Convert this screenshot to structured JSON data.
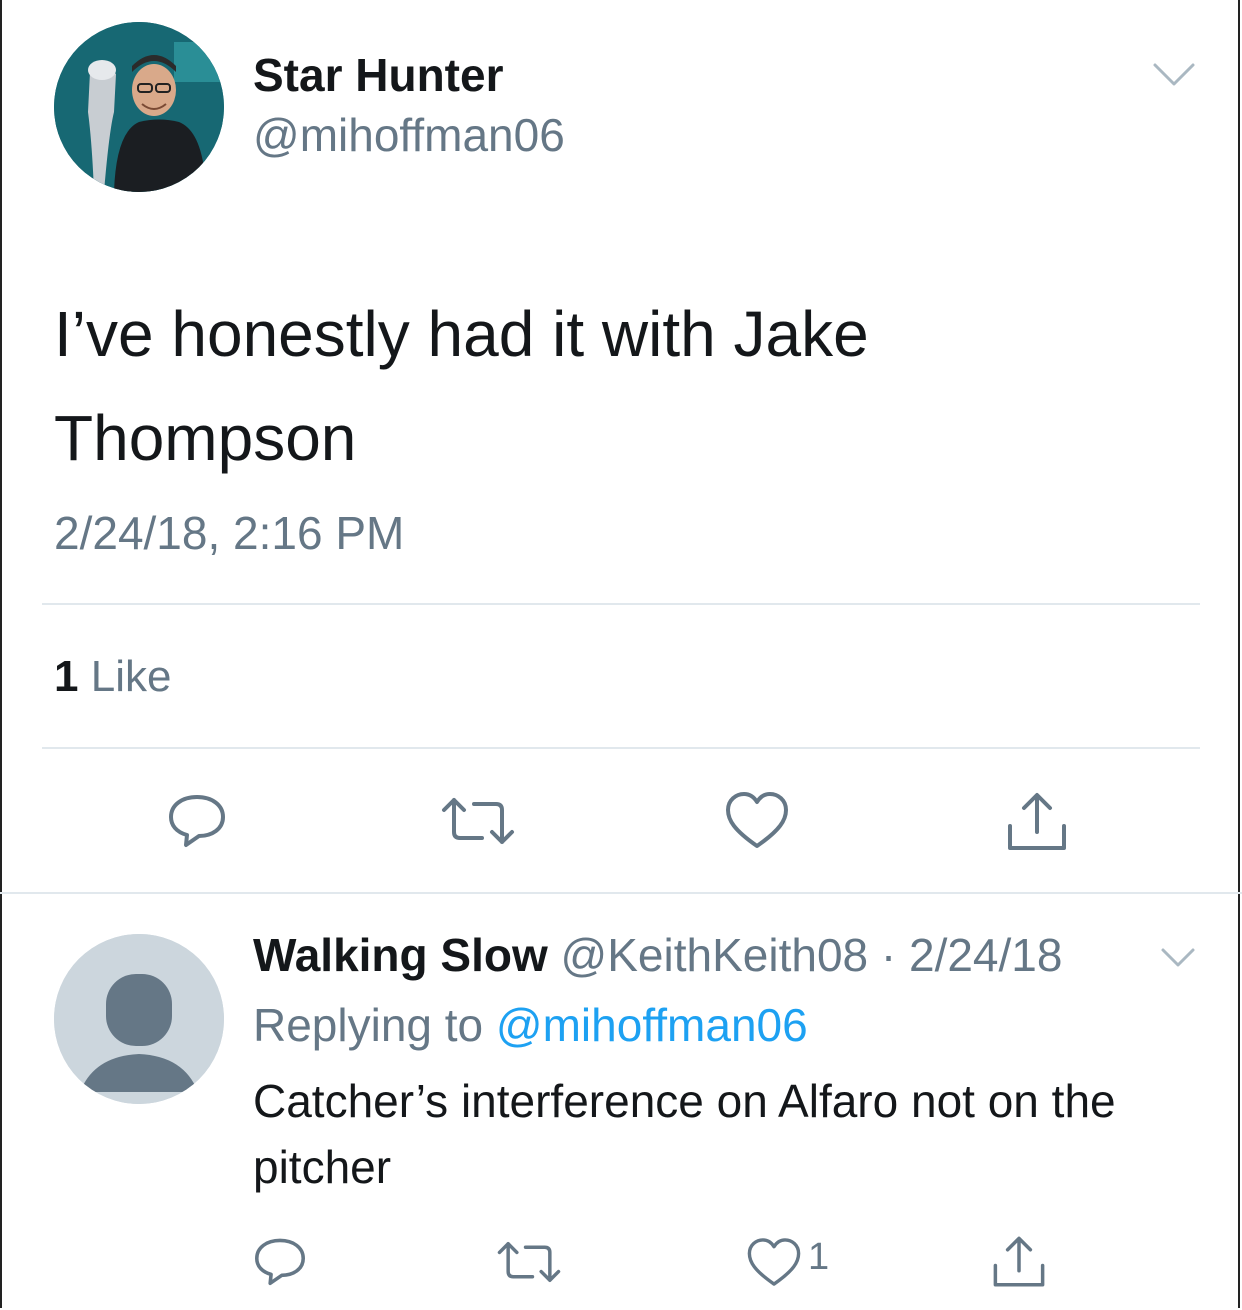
{
  "main_tweet": {
    "display_name": "Star Hunter",
    "handle": "@mihoffman06",
    "text": "I’ve honestly had it with Jake Thompson",
    "timestamp": "2/24/18, 2:16 PM",
    "like_count": "1",
    "like_label": "Like",
    "avatar_icon": "user-photo-avatar",
    "menu_icon": "chevron-down-icon",
    "actions": [
      "reply-icon",
      "retweet-icon",
      "heart-icon",
      "share-icon"
    ]
  },
  "reply": {
    "display_name": "Walking Slow",
    "handle_and_date": "@KeithKeith08 · 2/24/18",
    "replying_prefix": "Replying to",
    "replying_mention": "@mihoffman06",
    "text": "Catcher’s interference on Alfaro not on the pitcher",
    "like_count": "1",
    "avatar_icon": "default-avatar",
    "menu_icon": "chevron-down-icon",
    "actions": [
      "reply-icon",
      "retweet-icon",
      "heart-icon",
      "share-icon"
    ]
  },
  "colors": {
    "text": "#14171a",
    "secondary": "#657786",
    "link": "#1da1f2",
    "divider": "#e1e8ed",
    "avatar_placeholder": "#ccd6dd",
    "avatar_silhouette": "#657786"
  }
}
